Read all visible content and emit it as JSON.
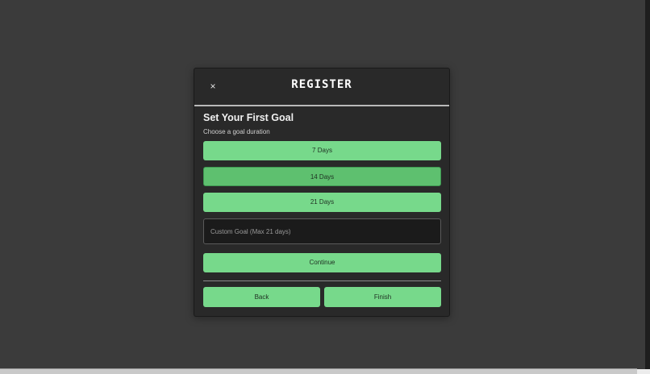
{
  "modal": {
    "close_label": "×",
    "brand": "REGISTER",
    "title": "Set Your First Goal",
    "subtitle": "Choose a goal duration",
    "options": [
      {
        "label": "7 Days",
        "selected": false
      },
      {
        "label": "14 Days",
        "selected": true
      },
      {
        "label": "21 Days",
        "selected": false
      }
    ],
    "custom_goal": {
      "placeholder": "Custom Goal (Max 21 days)",
      "value": ""
    },
    "continue_label": "Continue",
    "back_label": "Back",
    "finish_label": "Finish"
  },
  "colors": {
    "background": "#3b3b3b",
    "modal": "#292929",
    "accent": "#77d98b",
    "accent_selected": "#5ec06f"
  }
}
